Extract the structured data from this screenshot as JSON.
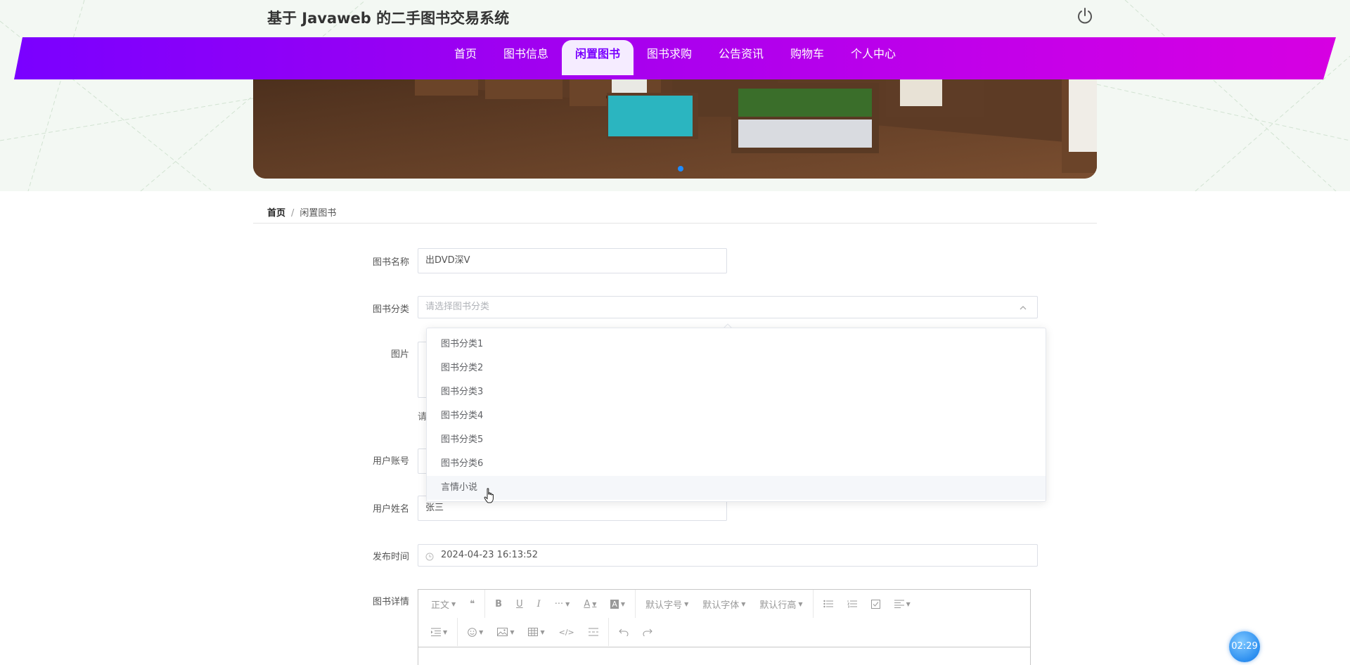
{
  "site": {
    "title": "基于 Javaweb 的二手图书交易系统"
  },
  "nav": {
    "items": [
      "首页",
      "图书信息",
      "闲置图书",
      "图书求购",
      "公告资讯",
      "购物车",
      "个人中心"
    ],
    "active_index": 2
  },
  "breadcrumb": {
    "home": "首页",
    "separator": "/",
    "current": "闲置图书"
  },
  "form": {
    "book_name": {
      "label": "图书名称",
      "value": "出DVD深V"
    },
    "category": {
      "label": "图书分类",
      "placeholder": "请选择图书分类"
    },
    "image": {
      "label": "图片",
      "hint": "请"
    },
    "account": {
      "label": "用户账号"
    },
    "username": {
      "label": "用户姓名",
      "value": "张三"
    },
    "publish_time": {
      "label": "发布时间",
      "value": "2024-04-23 16:13:52"
    },
    "detail": {
      "label": "图书详情"
    }
  },
  "dropdown": {
    "options": [
      "图书分类1",
      "图书分类2",
      "图书分类3",
      "图书分类4",
      "图书分类5",
      "图书分类6",
      "言情小说"
    ],
    "hovered_index": 6
  },
  "editor": {
    "toolbar_row1": [
      "正文",
      "❝",
      "B",
      "U",
      "I",
      "···",
      "A",
      "A",
      "默认字号",
      "默认字体",
      "默认行高"
    ],
    "font_size_label": "默认字号",
    "font_family_label": "默认字体",
    "line_height_label": "默认行高",
    "paragraph_label": "正文"
  },
  "timer": {
    "text": "02:29"
  },
  "colors": {
    "accent": "#7a00ff",
    "nav_gradient_end": "#d600e2",
    "timer": "#2d8ff0"
  }
}
